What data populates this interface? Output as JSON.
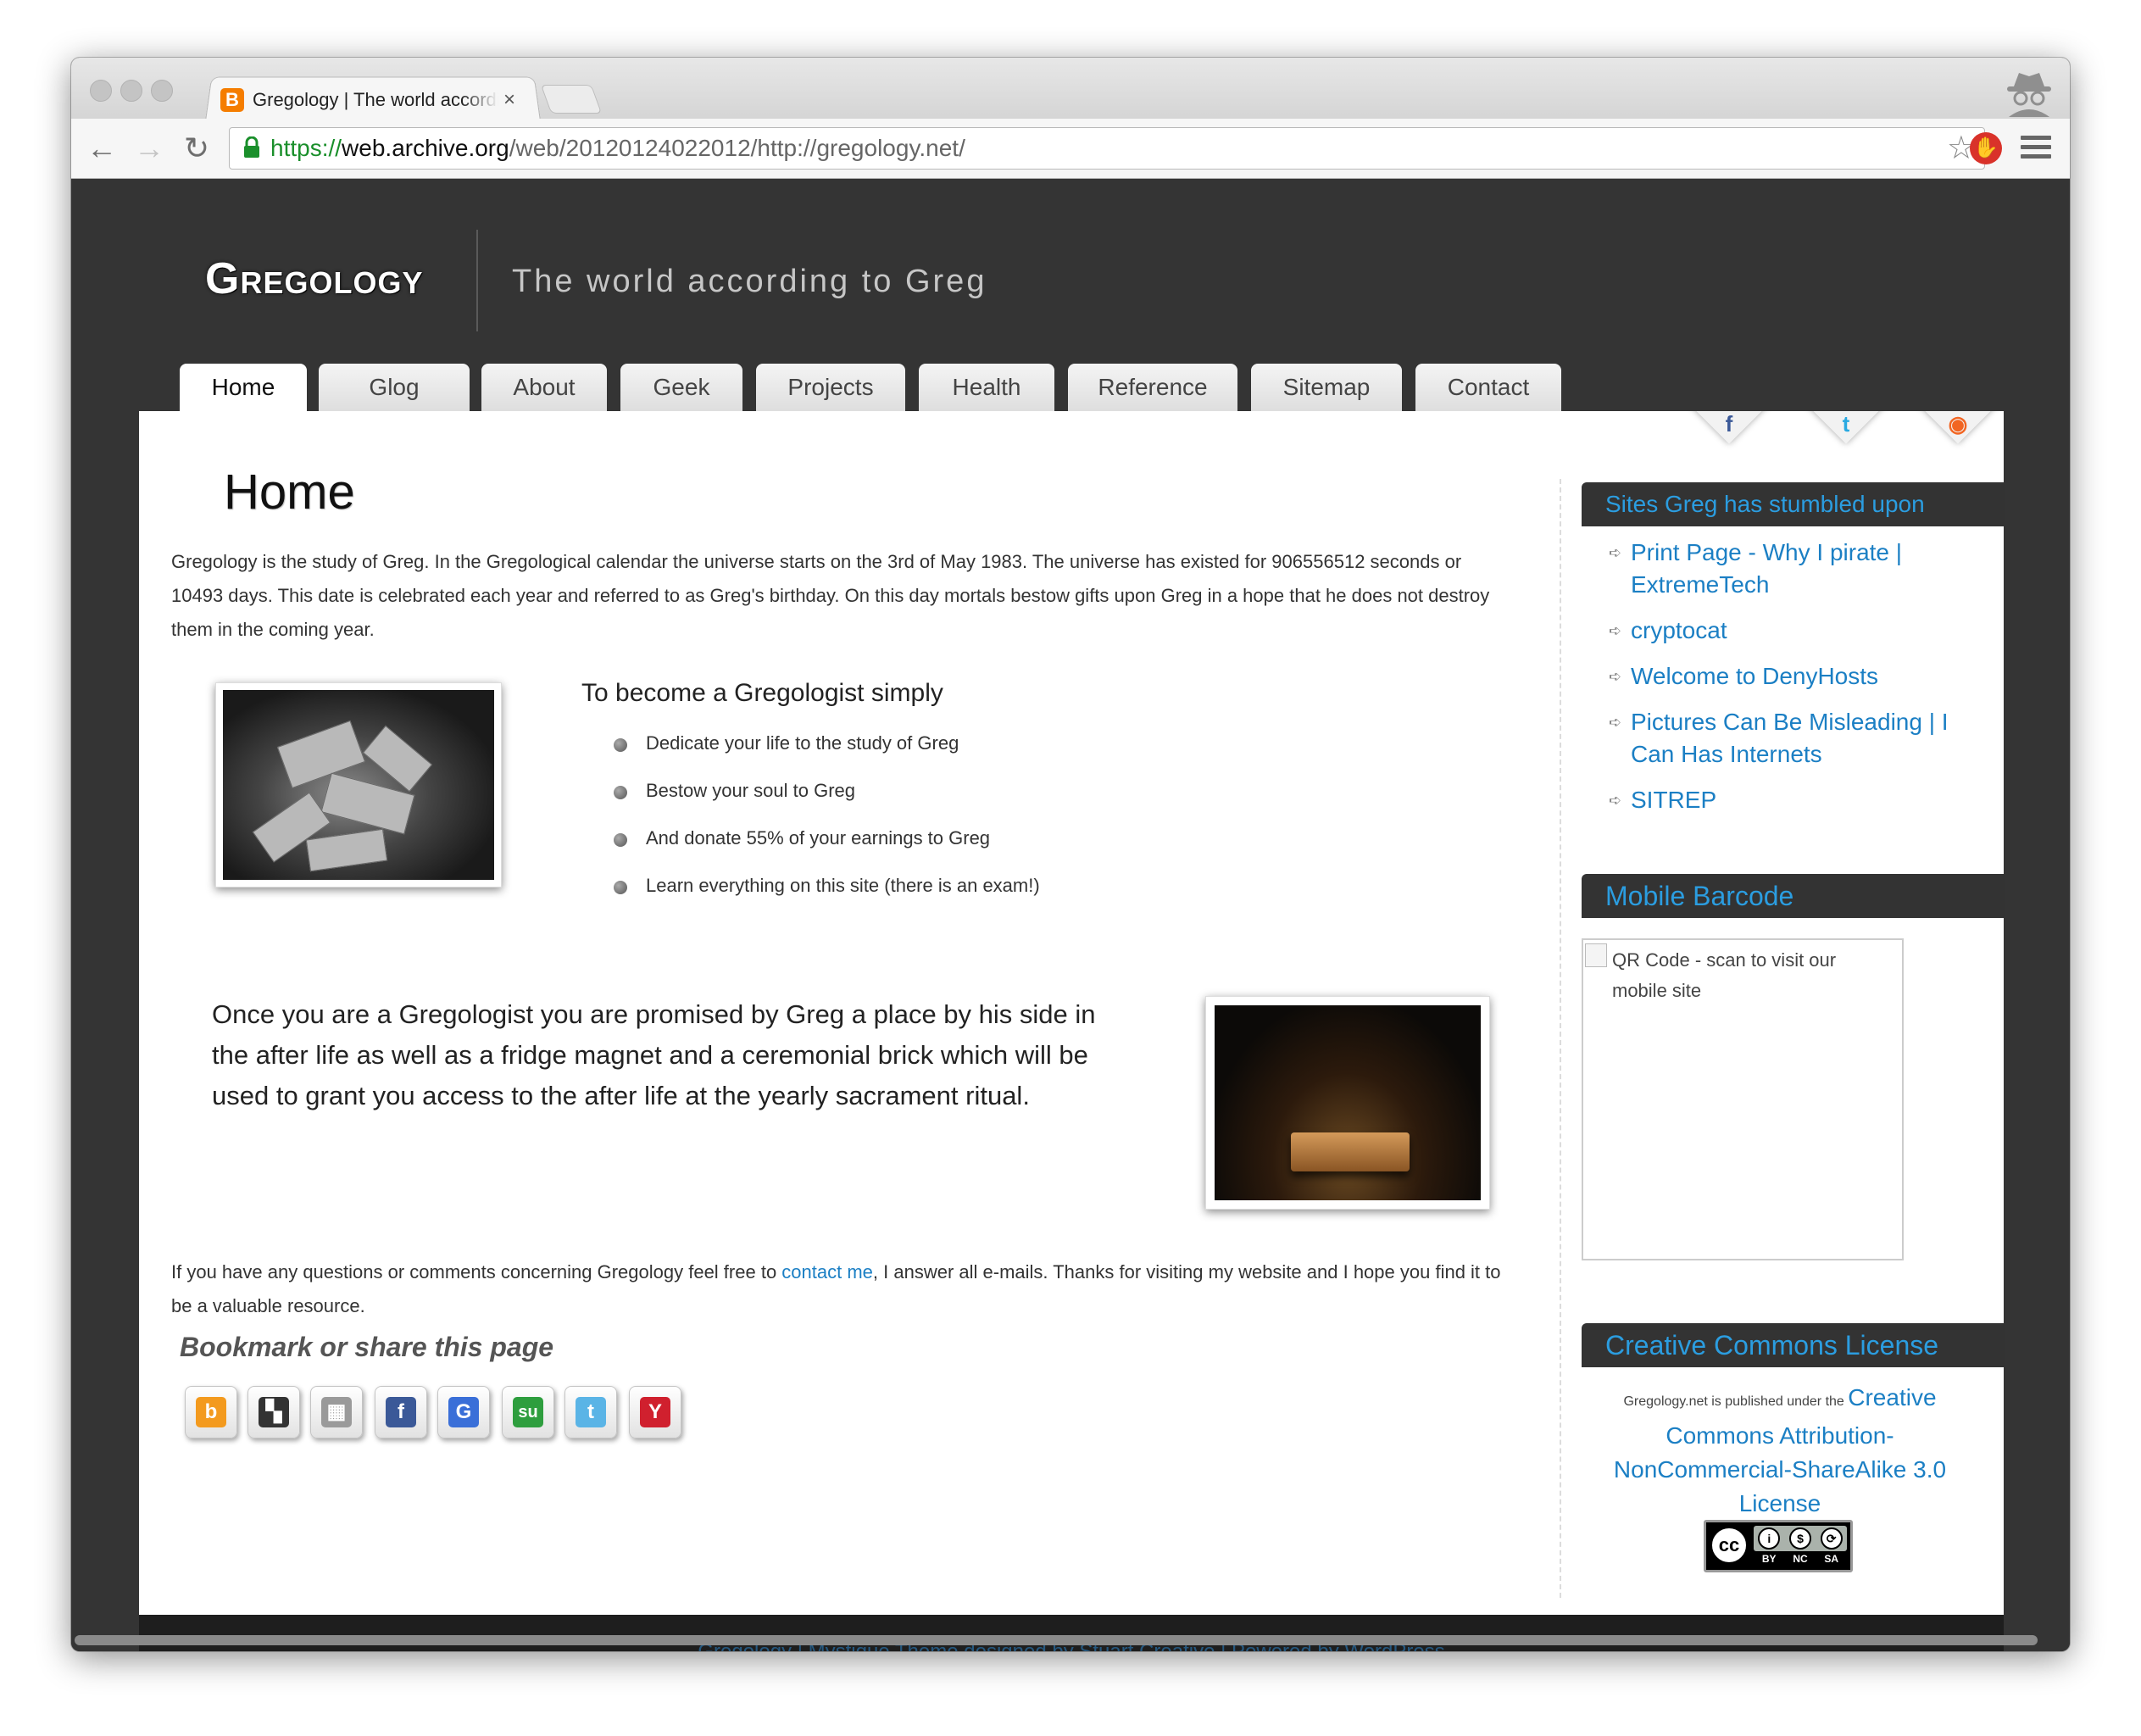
{
  "browser": {
    "tab_title": "Gregology | The world according to Greg",
    "favicon_letter": "B",
    "tab_close": "×",
    "url_scheme": "https://",
    "url_host": "web.archive.org",
    "url_rest": "/web/20120124022012/http://gregology.net/",
    "back_icon": "←",
    "forward_icon": "→",
    "reload_icon": "↻",
    "star_icon": "☆",
    "extension_icon": "✋"
  },
  "site": {
    "title": "Gregology",
    "tagline": "The world according to Greg"
  },
  "nav": {
    "tabs": [
      {
        "label": "Home"
      },
      {
        "label": "Glog"
      },
      {
        "label": "About"
      },
      {
        "label": "Geek"
      },
      {
        "label": "Projects"
      },
      {
        "label": "Health"
      },
      {
        "label": "Reference"
      },
      {
        "label": "Sitemap"
      },
      {
        "label": "Contact"
      }
    ]
  },
  "social": {
    "badges": [
      {
        "name": "facebook",
        "glyph": "f",
        "color": "#3b5998"
      },
      {
        "name": "twitter",
        "glyph": "t",
        "color": "#29a9e1"
      },
      {
        "name": "rss",
        "glyph": "◉",
        "color": "#f26522"
      }
    ]
  },
  "main": {
    "heading": "Home",
    "intro": "Gregology is the study of Greg. In the Gregological calendar the universe starts on the 3rd of May 1983. The universe has existed for 906556512 seconds or 10493 days. This date is celebrated each year and referred to as Greg's birthday. On this day mortals bestow gifts upon Greg in a hope that he does not destroy them in the coming year.",
    "become_heading": "To become a Gregologist simply",
    "become_items": [
      "Dedicate your life to the study of Greg",
      "Bestow your soul to Greg",
      "And donate 55% of your earnings to Greg",
      "Learn everything on this site (there is an exam!)"
    ],
    "promise": "Once you are a Gregologist you are promised by Greg a place by his side in the after life as well as a fridge magnet and a ceremonial brick which will be used to grant you access to the after life at the yearly sacrament ritual.",
    "closing_before": "If you have any questions or comments concerning Gregology feel free to ",
    "closing_link": "contact me",
    "closing_after": ", I answer all e-mails. Thanks for visiting my website and I hope you find it to be a valuable resource.",
    "share_heading": "Bookmark or share this page",
    "share_buttons": [
      {
        "name": "bebo",
        "glyph": "b",
        "color": "#f39a1e"
      },
      {
        "name": "delicious",
        "glyph": "▚",
        "color": "#333333"
      },
      {
        "name": "digg",
        "glyph": "▦",
        "color": "#9a9a9a"
      },
      {
        "name": "facebook",
        "glyph": "f",
        "color": "#3b5998"
      },
      {
        "name": "google",
        "glyph": "G",
        "color": "#3a6fd8"
      },
      {
        "name": "stumbleupon",
        "glyph": "su",
        "color": "#2e9e3e"
      },
      {
        "name": "twitter",
        "glyph": "t",
        "color": "#5ab4e6"
      },
      {
        "name": "yahoo",
        "glyph": "Y",
        "color": "#d0202e"
      }
    ]
  },
  "sidebar": {
    "sites_title": "Sites Greg has stumbled upon",
    "sites": [
      "Print Page - Why I pirate | ExtremeTech",
      "cryptocat",
      "Welcome to DenyHosts",
      "Pictures Can Be Misleading | I Can Has Internets",
      "SITREP"
    ],
    "barcode_title": "Mobile Barcode",
    "qr_alt": "QR Code - scan to visit our mobile site",
    "cc_title": "Creative Commons License",
    "cc_small": "Gregology.net is published under the ",
    "cc_link": "Creative Commons Attribution-NonCommercial-ShareAlike 3.0 License",
    "cc_badge_main": "cc",
    "cc_badge_labels": [
      "BY",
      "NC",
      "SA"
    ]
  },
  "footer": {
    "text": "Gregology | Mystique Theme designed by Stuart Creative | Powered by WordPress"
  }
}
